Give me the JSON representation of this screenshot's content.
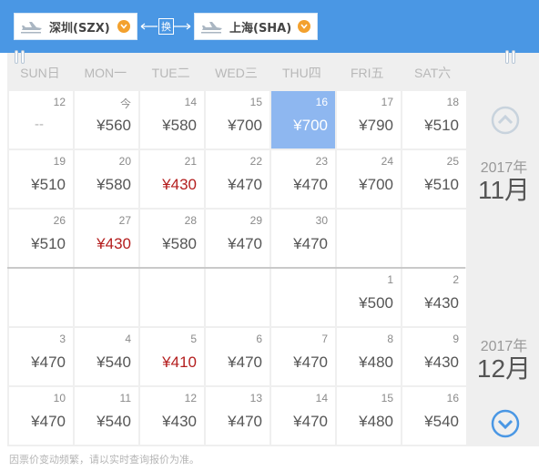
{
  "header": {
    "from_city": "深圳(SZX)",
    "to_city": "上海(SHA)",
    "swap_label": "换"
  },
  "weekdays": [
    "SUN日",
    "MON一",
    "TUE二",
    "WED三",
    "THU四",
    "FRI五",
    "SAT六"
  ],
  "november": {
    "year_label": "2017年",
    "month_label": "11月",
    "weeks": [
      [
        {
          "day": "12",
          "price": "--"
        },
        {
          "day": "今",
          "price": "¥560"
        },
        {
          "day": "14",
          "price": "¥580"
        },
        {
          "day": "15",
          "price": "¥700"
        },
        {
          "day": "16",
          "price": "¥700",
          "selected": true
        },
        {
          "day": "17",
          "price": "¥790"
        },
        {
          "day": "18",
          "price": "¥510"
        }
      ],
      [
        {
          "day": "19",
          "price": "¥510"
        },
        {
          "day": "20",
          "price": "¥580"
        },
        {
          "day": "21",
          "price": "¥430",
          "low": true
        },
        {
          "day": "22",
          "price": "¥470"
        },
        {
          "day": "23",
          "price": "¥470"
        },
        {
          "day": "24",
          "price": "¥700"
        },
        {
          "day": "25",
          "price": "¥510"
        }
      ],
      [
        {
          "day": "26",
          "price": "¥510"
        },
        {
          "day": "27",
          "price": "¥430",
          "low": true
        },
        {
          "day": "28",
          "price": "¥580"
        },
        {
          "day": "29",
          "price": "¥470"
        },
        {
          "day": "30",
          "price": "¥470"
        },
        {
          "day": "",
          "price": ""
        },
        {
          "day": "",
          "price": ""
        }
      ]
    ]
  },
  "december": {
    "year_label": "2017年",
    "month_label": "12月",
    "weeks": [
      [
        {
          "day": "",
          "price": ""
        },
        {
          "day": "",
          "price": ""
        },
        {
          "day": "",
          "price": ""
        },
        {
          "day": "",
          "price": ""
        },
        {
          "day": "",
          "price": ""
        },
        {
          "day": "1",
          "price": "¥500"
        },
        {
          "day": "2",
          "price": "¥430"
        }
      ],
      [
        {
          "day": "3",
          "price": "¥470"
        },
        {
          "day": "4",
          "price": "¥540"
        },
        {
          "day": "5",
          "price": "¥410",
          "low": true
        },
        {
          "day": "6",
          "price": "¥470"
        },
        {
          "day": "7",
          "price": "¥470"
        },
        {
          "day": "8",
          "price": "¥480"
        },
        {
          "day": "9",
          "price": "¥430"
        }
      ],
      [
        {
          "day": "10",
          "price": "¥470"
        },
        {
          "day": "11",
          "price": "¥540"
        },
        {
          "day": "12",
          "price": "¥430"
        },
        {
          "day": "13",
          "price": "¥470"
        },
        {
          "day": "14",
          "price": "¥470"
        },
        {
          "day": "15",
          "price": "¥480"
        },
        {
          "day": "16",
          "price": "¥540"
        }
      ]
    ]
  },
  "footer_note": "因票价变动频繁，请以实时查询报价为准。",
  "colors": {
    "header_bg": "#4a97e4",
    "selected_bg": "#8eb7f0",
    "low_price": "#b41e1e",
    "dropdown_accent": "#f3a12e",
    "nav_icon": "#4a97e4",
    "nav_icon_disabled": "#c8d3dd"
  },
  "icons": {
    "plane": "plane-icon",
    "dropdown": "chevron-down-icon",
    "swap": "swap-arrows-icon",
    "prev": "chevron-up-circle-icon",
    "next": "chevron-down-circle-icon"
  }
}
